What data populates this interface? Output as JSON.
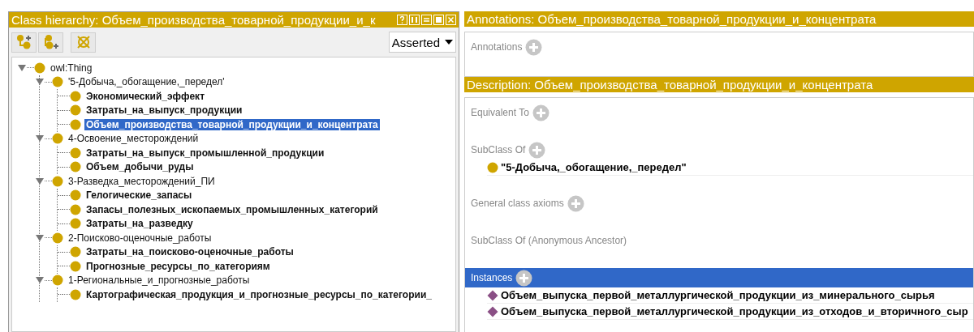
{
  "left_panel": {
    "title": "Class hierarchy: Объем_производства_товарной_продукции_и_к",
    "toolbar": {
      "view_select": "Asserted"
    },
    "tree": [
      {
        "label": "owl:Thing",
        "bold": false,
        "selected": false,
        "expanded": true,
        "children": [
          {
            "label": "'5-Добыча,_обогащение,_передел'",
            "bold": false,
            "selected": false,
            "expanded": true,
            "children": [
              {
                "label": "Экономический_эффект",
                "bold": true,
                "selected": false
              },
              {
                "label": "Затраты_на_выпуск_продукции",
                "bold": true,
                "selected": false
              },
              {
                "label": "Объем_производства_товарной_продукции_и_концентрата",
                "bold": true,
                "selected": true
              }
            ]
          },
          {
            "label": "4-Освоение_месторождений",
            "bold": false,
            "selected": false,
            "expanded": true,
            "children": [
              {
                "label": "Затраты_на_выпуск_промышленной_продукции",
                "bold": true,
                "selected": false
              },
              {
                "label": "Объем_добычи_руды",
                "bold": true,
                "selected": false
              }
            ]
          },
          {
            "label": "3-Разведка_месторождений_ПИ",
            "bold": false,
            "selected": false,
            "expanded": true,
            "children": [
              {
                "label": "Гелогические_запасы",
                "bold": true,
                "selected": false
              },
              {
                "label": "Запасы_полезных_ископаемых_промышленных_категорий",
                "bold": true,
                "selected": false
              },
              {
                "label": "Затраты_на_разведку",
                "bold": true,
                "selected": false
              }
            ]
          },
          {
            "label": "2-Поисково-оценочные_работы",
            "bold": false,
            "selected": false,
            "expanded": true,
            "children": [
              {
                "label": "Затраты_на_поисково-оценочные_работы",
                "bold": true,
                "selected": false
              },
              {
                "label": "Прогнозные_ресурсы_по_категориям",
                "bold": true,
                "selected": false
              }
            ]
          },
          {
            "label": "1-Региональные_и_прогнозные_работы",
            "bold": false,
            "selected": false,
            "expanded": true,
            "children": [
              {
                "label": "Картографическая_продукция_и_прогнозные_ресурсы_по_категории_",
                "bold": true,
                "selected": false
              }
            ]
          }
        ]
      }
    ]
  },
  "annotations_panel": {
    "title": "Annotations: Объем_производства_товарной_продукции_и_концентрата",
    "sections": [
      {
        "label": "Annotations",
        "addable": true,
        "selected": false
      }
    ]
  },
  "description_panel": {
    "title": "Description: Объем_производства_товарной_продукции_и_концентрата",
    "sections": [
      {
        "label": "Equivalent To",
        "addable": true,
        "selected": false
      },
      {
        "label": "SubClass Of",
        "addable": true,
        "selected": false,
        "items": [
          {
            "kind": "class",
            "label": "\"5-Добыча,_обогащение,_передел\""
          }
        ]
      },
      {
        "label": "General class axioms",
        "addable": true,
        "selected": false
      },
      {
        "label": "SubClass Of (Anonymous Ancestor)",
        "addable": false,
        "selected": false
      },
      {
        "label": "Instances",
        "addable": true,
        "selected": true,
        "items": [
          {
            "kind": "individual",
            "label": "Объем_выпуска_первой_металлургической_продукции_из_минерального_сырья"
          },
          {
            "kind": "individual",
            "label": "Объем_выпуска_первой_металлургической_продукции_из_отходов_и_вторичного_сыр"
          }
        ]
      }
    ]
  }
}
